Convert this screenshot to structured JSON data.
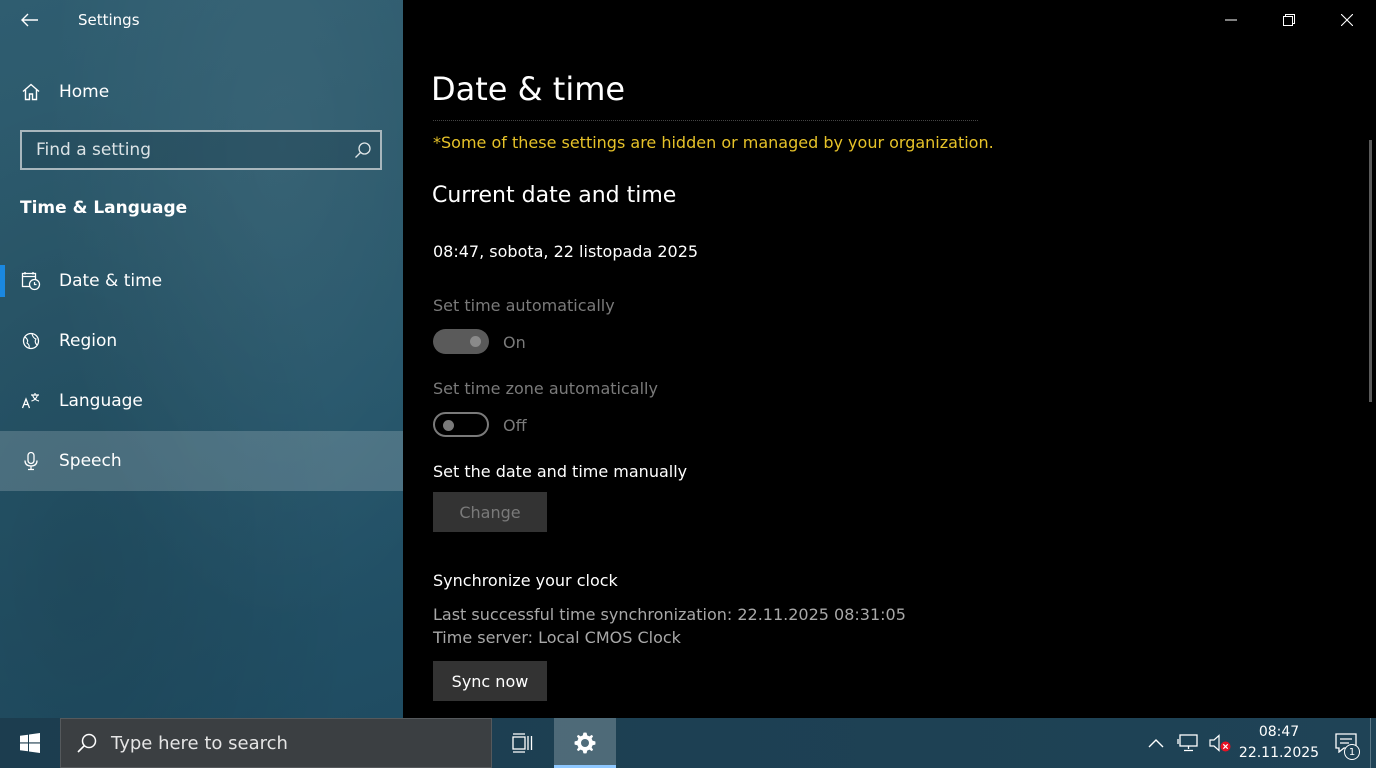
{
  "window": {
    "title": "Settings"
  },
  "sidebar": {
    "home_label": "Home",
    "search_placeholder": "Find a setting",
    "section_title": "Time & Language",
    "items": [
      {
        "label": "Date & time",
        "icon": "calendar-clock-icon",
        "selected": true
      },
      {
        "label": "Region",
        "icon": "globe-icon",
        "selected": false
      },
      {
        "label": "Language",
        "icon": "language-icon",
        "selected": false
      },
      {
        "label": "Speech",
        "icon": "microphone-icon",
        "selected": false,
        "hover": true
      }
    ]
  },
  "main": {
    "page_title": "Date & time",
    "notice": "*Some of these settings are hidden or managed by your organization.",
    "current_heading": "Current date and time",
    "current_value": "08:47, sobota, 22 listopada 2025",
    "set_time_auto": {
      "label": "Set time automatically",
      "state": "On"
    },
    "set_tz_auto": {
      "label": "Set time zone automatically",
      "state": "Off"
    },
    "manual_label": "Set the date and time manually",
    "change_button": "Change",
    "sync_heading": "Synchronize your clock",
    "last_sync": "Last successful time synchronization: 22.11.2025 08:31:05",
    "time_server": "Time server: Local CMOS Clock",
    "sync_button": "Sync now"
  },
  "taskbar": {
    "search_placeholder": "Type here to search",
    "clock_time": "08:47",
    "clock_date": "22.11.2025",
    "notification_count": "1"
  },
  "colors": {
    "accent": "#1a88e0",
    "notice": "#e6c229",
    "sidebar": "#2a586b"
  }
}
